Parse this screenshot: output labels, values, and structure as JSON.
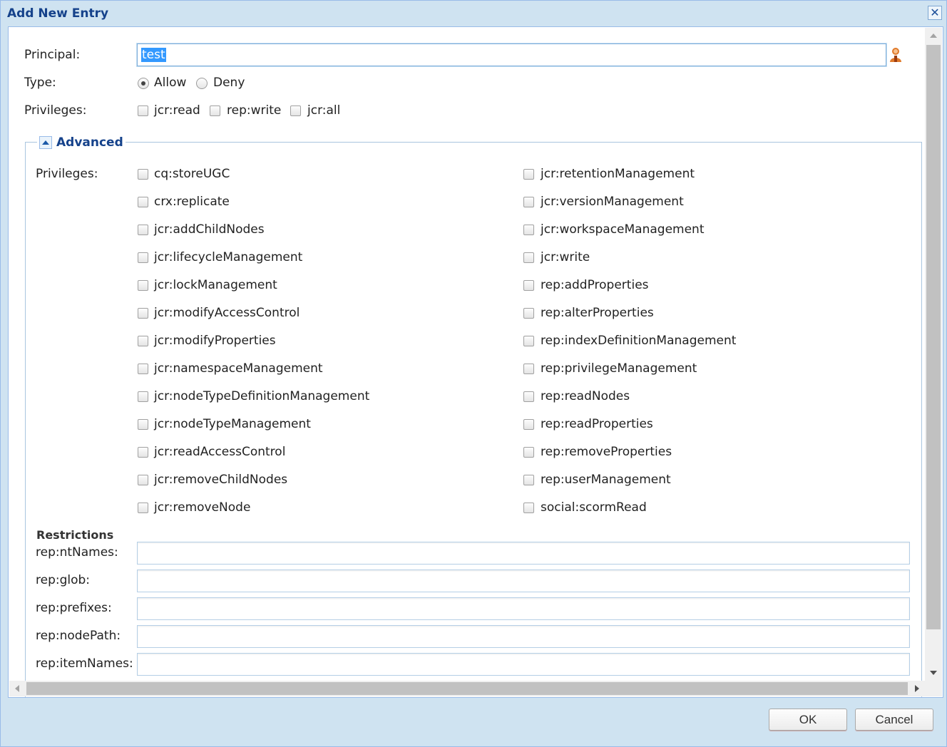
{
  "dialog": {
    "title": "Add New Entry"
  },
  "principal": {
    "label": "Principal:",
    "value": "test"
  },
  "type": {
    "label": "Type:",
    "options": [
      "Allow",
      "Deny"
    ],
    "selected": "Allow"
  },
  "privileges": {
    "label": "Privileges:",
    "options": [
      "jcr:read",
      "rep:write",
      "jcr:all"
    ]
  },
  "advanced": {
    "title": "Advanced",
    "privileges_label": "Privileges:",
    "left_column": [
      "cq:storeUGC",
      "crx:replicate",
      "jcr:addChildNodes",
      "jcr:lifecycleManagement",
      "jcr:lockManagement",
      "jcr:modifyAccessControl",
      "jcr:modifyProperties",
      "jcr:namespaceManagement",
      "jcr:nodeTypeDefinitionManagement",
      "jcr:nodeTypeManagement",
      "jcr:readAccessControl",
      "jcr:removeChildNodes",
      "jcr:removeNode"
    ],
    "right_column": [
      "jcr:retentionManagement",
      "jcr:versionManagement",
      "jcr:workspaceManagement",
      "jcr:write",
      "rep:addProperties",
      "rep:alterProperties",
      "rep:indexDefinitionManagement",
      "rep:privilegeManagement",
      "rep:readNodes",
      "rep:readProperties",
      "rep:removeProperties",
      "rep:userManagement",
      "social:scormRead"
    ]
  },
  "restrictions": {
    "title": "Restrictions",
    "fields": [
      {
        "label": "rep:ntNames:",
        "value": ""
      },
      {
        "label": "rep:glob:",
        "value": ""
      },
      {
        "label": "rep:prefixes:",
        "value": ""
      },
      {
        "label": "rep:nodePath:",
        "value": ""
      },
      {
        "label": "rep:itemNames:",
        "value": ""
      }
    ]
  },
  "buttons": {
    "ok": "OK",
    "cancel": "Cancel"
  },
  "colors": {
    "title_blue": "#15428b",
    "frame_bg": "#cfe3f1",
    "selection": "#3399ff",
    "user_icon": "#e07a2a"
  }
}
